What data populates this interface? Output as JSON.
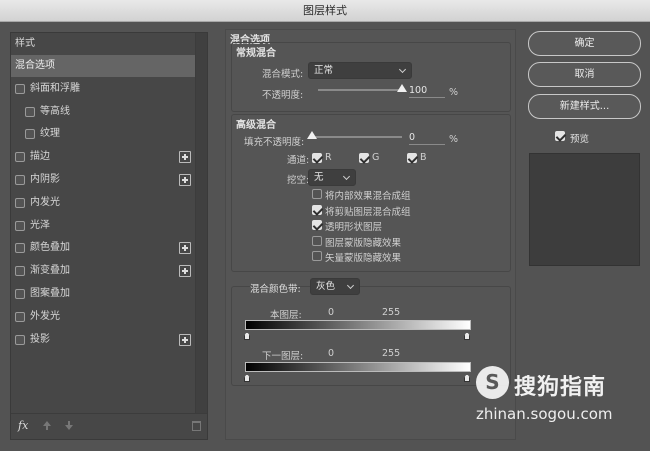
{
  "window": {
    "title": "图层样式"
  },
  "styles_panel": {
    "header": "样式",
    "items": [
      {
        "label": "混合选项",
        "checkbox": false,
        "selected": true,
        "plus": false,
        "indent": 0
      },
      {
        "label": "斜面和浮雕",
        "checkbox": true,
        "checked": false,
        "plus": false,
        "indent": 0
      },
      {
        "label": "等高线",
        "checkbox": true,
        "checked": false,
        "plus": false,
        "indent": 1
      },
      {
        "label": "纹理",
        "checkbox": true,
        "checked": false,
        "plus": false,
        "indent": 1
      },
      {
        "label": "描边",
        "checkbox": true,
        "checked": false,
        "plus": true,
        "indent": 0
      },
      {
        "label": "内阴影",
        "checkbox": true,
        "checked": false,
        "plus": true,
        "indent": 0
      },
      {
        "label": "内发光",
        "checkbox": true,
        "checked": false,
        "plus": false,
        "indent": 0
      },
      {
        "label": "光泽",
        "checkbox": true,
        "checked": false,
        "plus": false,
        "indent": 0
      },
      {
        "label": "颜色叠加",
        "checkbox": true,
        "checked": false,
        "plus": true,
        "indent": 0
      },
      {
        "label": "渐变叠加",
        "checkbox": true,
        "checked": false,
        "plus": true,
        "indent": 0
      },
      {
        "label": "图案叠加",
        "checkbox": true,
        "checked": false,
        "plus": false,
        "indent": 0
      },
      {
        "label": "外发光",
        "checkbox": true,
        "checked": false,
        "plus": false,
        "indent": 0
      },
      {
        "label": "投影",
        "checkbox": true,
        "checked": false,
        "plus": true,
        "indent": 0
      }
    ],
    "footer_fx": "fx"
  },
  "blend": {
    "section_title": "混合选项",
    "general": {
      "title": "常规混合",
      "mode_label": "混合模式:",
      "mode_value": "正常",
      "opacity_label": "不透明度:",
      "opacity_value": "100",
      "opacity_unit": "%",
      "opacity_fraction": 1.0
    },
    "advanced": {
      "title": "高级混合",
      "fill_label": "填充不透明度:",
      "fill_value": "0",
      "fill_unit": "%",
      "fill_fraction": 0.0,
      "channels_label": "通道:",
      "channel_r": "R",
      "channel_g": "G",
      "channel_b": "B",
      "knockout_label": "挖空:",
      "knockout_value": "无",
      "options": [
        {
          "label": "将内部效果混合成组",
          "checked": false
        },
        {
          "label": "将剪贴图层混合成组",
          "checked": true
        },
        {
          "label": "透明形状图层",
          "checked": true
        },
        {
          "label": "图层蒙版隐藏效果",
          "checked": false
        },
        {
          "label": "矢量蒙版隐藏效果",
          "checked": false
        }
      ]
    },
    "blend_if": {
      "label": "混合颜色带:",
      "value": "灰色",
      "this_layer_label": "本图层:",
      "this_layer_min": "0",
      "this_layer_max": "255",
      "underlying_label": "下一图层:",
      "underlying_min": "0",
      "underlying_max": "255"
    }
  },
  "buttons": {
    "ok": "确定",
    "cancel": "取消",
    "new_style": "新建样式...",
    "preview_label": "预览",
    "preview_checked": true
  },
  "watermark": {
    "logo_letter": "S",
    "brand": "搜狗指南",
    "url": "zhinan.sogou.com"
  }
}
